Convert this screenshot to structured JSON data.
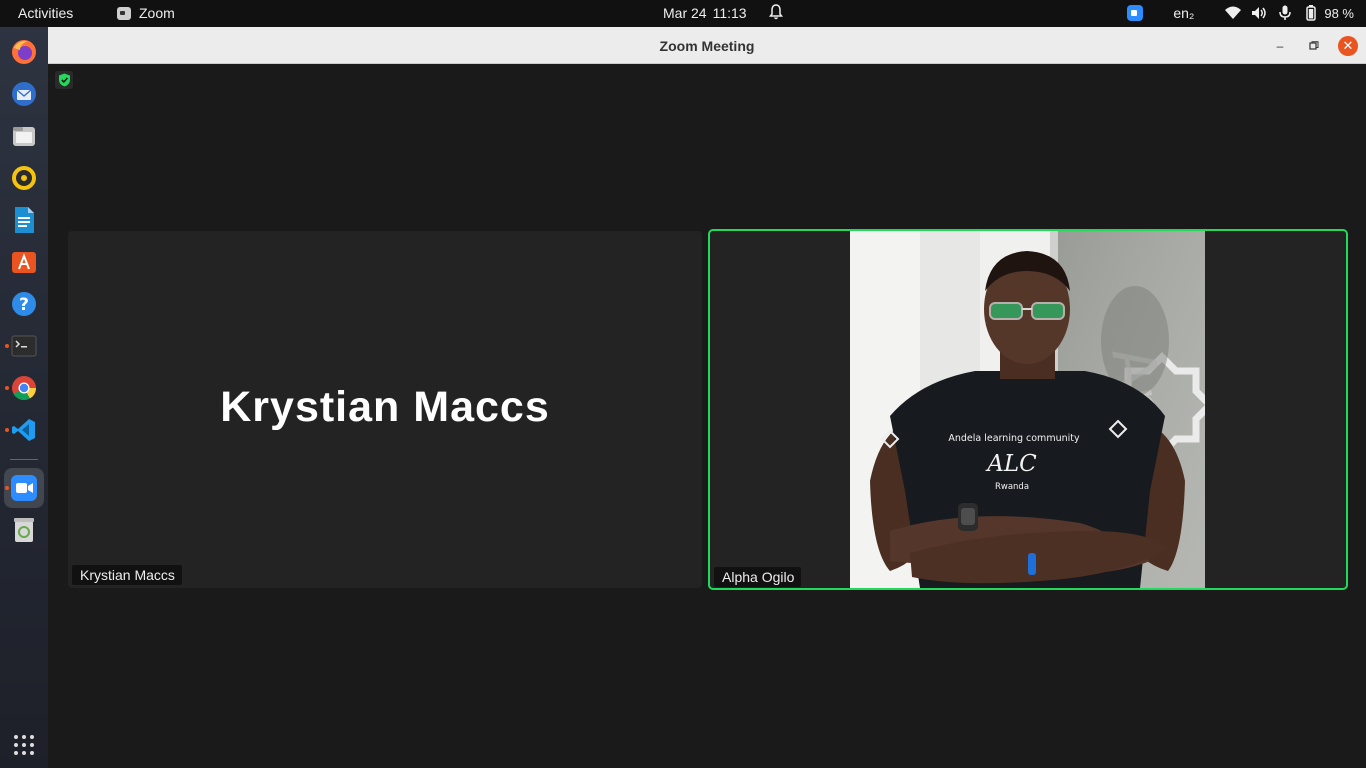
{
  "topbar": {
    "activities": "Activities",
    "app_name": "Zoom",
    "date": "Mar 24",
    "time": "11:13",
    "language": "en₂",
    "battery": "98 %"
  },
  "dock": {
    "items": [
      {
        "name": "firefox",
        "color": "#ff7139"
      },
      {
        "name": "thunderbird",
        "color": "#2f6ecb"
      },
      {
        "name": "files",
        "color": "#bcbcbc"
      },
      {
        "name": "rhythmbox",
        "color": "#f4c40f"
      },
      {
        "name": "libreoffice-writer",
        "color": "#1b8fd2"
      },
      {
        "name": "ubuntu-software",
        "color": "#e95420"
      },
      {
        "name": "help",
        "color": "#2f8be8"
      },
      {
        "name": "terminal",
        "color": "#2c2c2c"
      },
      {
        "name": "chrome",
        "color": "#db4437"
      },
      {
        "name": "vscode",
        "color": "#1f9cf0"
      },
      {
        "name": "zoom",
        "color": "#2d8cff"
      },
      {
        "name": "trash",
        "color": "#6aa84f"
      }
    ]
  },
  "window": {
    "title": "Zoom Meeting",
    "minimize_icon": "–",
    "maximize_icon": "□",
    "close_icon": "✕"
  },
  "participants": [
    {
      "name": "Krystian Maccs",
      "video": false
    },
    {
      "name": "Alpha Ogilo",
      "video": true,
      "active_speaker": true
    }
  ],
  "shirt_text": {
    "line1": "Andela learning community",
    "line2": "ALC",
    "line3": "Rwanda"
  },
  "colors": {
    "active_speaker_border": "#23d959",
    "zoom_blue": "#2d8cff",
    "close_button": "#e95420"
  }
}
